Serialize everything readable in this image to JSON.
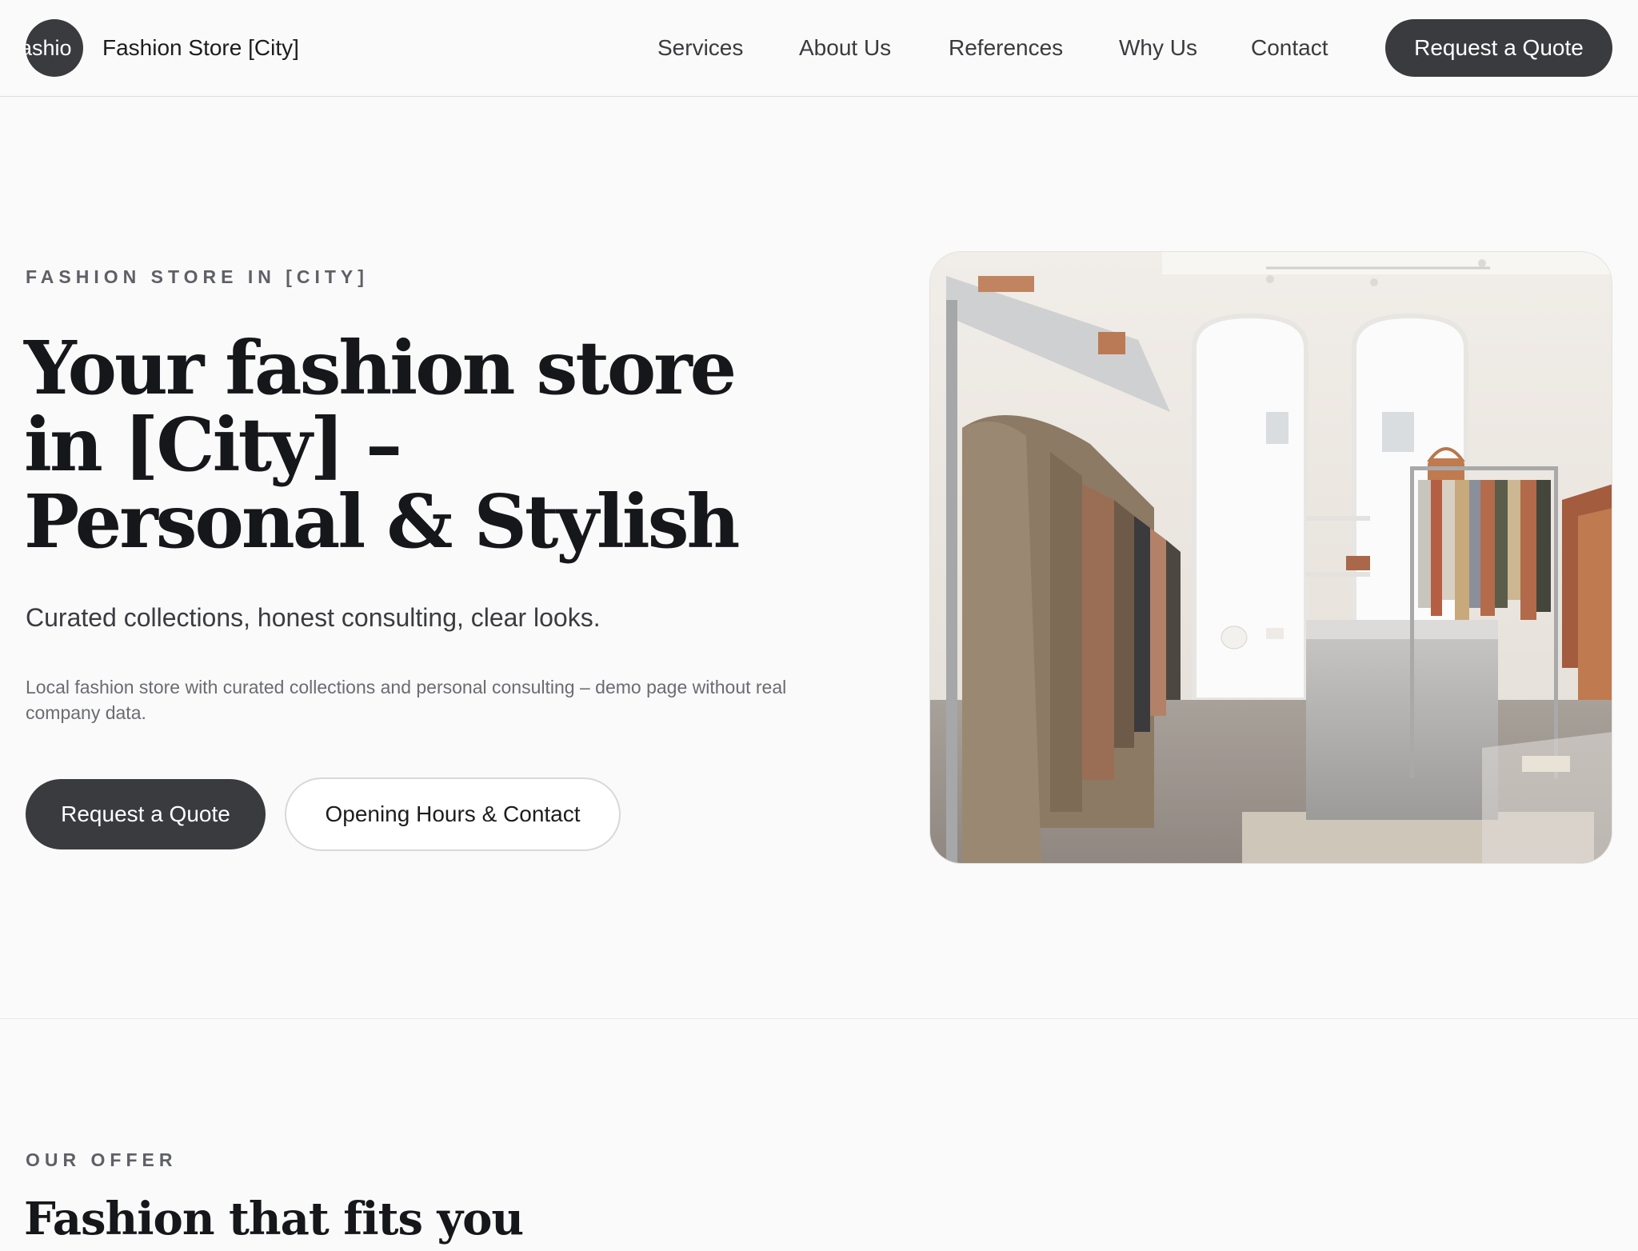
{
  "header": {
    "logo_text": "ashio",
    "brand_name": "Fashion Store [City]",
    "nav": [
      "Services",
      "About Us",
      "References",
      "Why Us",
      "Contact"
    ],
    "cta_label": "Request a Quote"
  },
  "hero": {
    "eyebrow": "FASHION STORE IN [CITY]",
    "title": "Your fashion store in [City] – Personal & Stylish",
    "subtitle": "Curated collections, honest consulting, clear looks.",
    "description": "Local fashion store with curated collections and personal consulting – demo page without real company data.",
    "primary_cta": "Request a Quote",
    "secondary_cta": "Opening Hours & Contact",
    "image_icon": "store-interior-photo"
  },
  "offer": {
    "eyebrow": "OUR OFFER",
    "title": "Fashion that fits you"
  },
  "colors": {
    "background": "#fafafa",
    "button_dark": "#3a3b3f",
    "text_primary": "#16171a",
    "text_muted": "#6b6c72"
  }
}
